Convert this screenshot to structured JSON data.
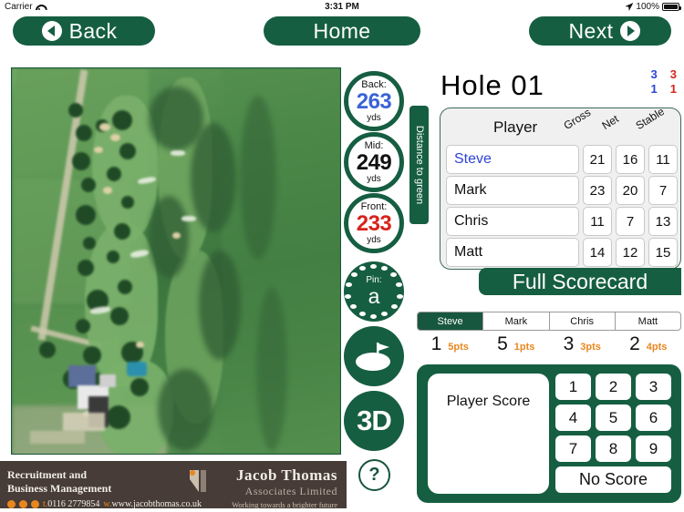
{
  "status_bar": {
    "carrier": "Carrier",
    "wifi_icon": "wifi-icon",
    "time": "3:31 PM",
    "location_icon": "location-arrow-icon",
    "battery_percent": "100%",
    "battery_icon": "battery-full-icon"
  },
  "nav": {
    "back_label": "Back",
    "home_label": "Home",
    "next_label": "Next",
    "back_icon": "chevron-left-circle-icon",
    "next_icon": "chevron-right-circle-icon"
  },
  "distances": {
    "side_label": "Distance to green",
    "units": "yds",
    "items": [
      {
        "label": "Back:",
        "value": "263",
        "color": "#3a63d8"
      },
      {
        "label": "Mid:",
        "value": "249",
        "color": "#111111"
      },
      {
        "label": "Front:",
        "value": "233",
        "color": "#d8231c"
      }
    ]
  },
  "tools": {
    "pin_label": "Pin:",
    "pin_position": "a",
    "pin_icon": "golf-ball-icon",
    "green_icon": "green-flag-icon",
    "three_d_label": "3D",
    "help_label": "?"
  },
  "hole": {
    "title": "Hole 01",
    "par_blue_top": "3",
    "par_blue_bottom": "1",
    "par_red_top": "3",
    "par_red_bottom": "1"
  },
  "scorecard": {
    "headers": {
      "player": "Player",
      "gross": "Gross",
      "net": "Net",
      "stable": "Stable"
    },
    "rows": [
      {
        "player": "Steve",
        "gross": "21",
        "net": "16",
        "stable": "11",
        "active": true
      },
      {
        "player": "Mark",
        "gross": "23",
        "net": "20",
        "stable": "7",
        "active": false
      },
      {
        "player": "Chris",
        "gross": "11",
        "net": "7",
        "stable": "13",
        "active": false
      },
      {
        "player": "Matt",
        "gross": "14",
        "net": "12",
        "stable": "15",
        "active": false
      }
    ],
    "full_scorecard_label": "Full Scorecard"
  },
  "player_tabs": {
    "tabs": [
      {
        "name": "Steve",
        "selected": true
      },
      {
        "name": "Mark",
        "selected": false
      },
      {
        "name": "Chris",
        "selected": false
      },
      {
        "name": "Matt",
        "selected": false
      }
    ],
    "scores": [
      {
        "strokes": "1",
        "points": "5pts"
      },
      {
        "strokes": "5",
        "points": "1pts"
      },
      {
        "strokes": "3",
        "points": "3pts"
      },
      {
        "strokes": "2",
        "points": "4pts"
      }
    ],
    "points_color": "#e8871e"
  },
  "keypad": {
    "display_label": "Player Score",
    "keys": [
      "1",
      "2",
      "3",
      "4",
      "5",
      "6",
      "7",
      "8",
      "9"
    ],
    "no_score_label": "No Score"
  },
  "advert": {
    "line1": "Recruitment and",
    "line2": "Business Management",
    "phone_prefix": "t.",
    "phone": "0116 2779854",
    "web_prefix": "w.",
    "web": "www.jacobthomas.co.uk",
    "brand_line1": "Jacob Thomas",
    "brand_line2": "Associates Limited",
    "tagline": "Working towards a brighter future"
  },
  "theme": {
    "green": "#165e42",
    "dark_green": "#18573f",
    "orange": "#e8871e",
    "blue": "#2d44d8",
    "red": "#d8231c"
  }
}
